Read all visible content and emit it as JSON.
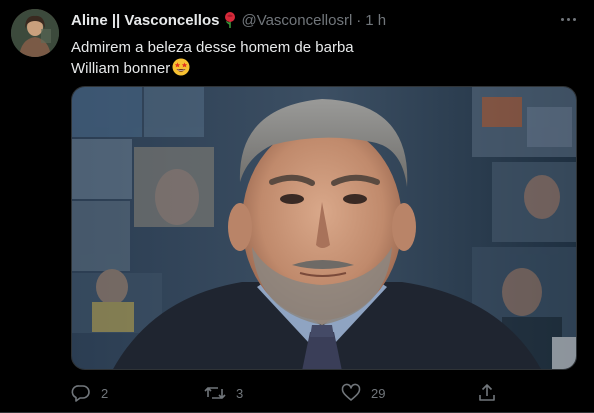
{
  "tweet": {
    "display_name": "Aline || Vasconcellos",
    "name_emoji": "rose-icon",
    "handle": "@Vasconcellosrl",
    "separator": "·",
    "time": "1 h",
    "text_line1": "Admirem a beleza desse homem de barba",
    "text_line2": "William bonner",
    "text_emoji": "star-struck-emoji-icon"
  },
  "actions": {
    "reply_count": "2",
    "retweet_count": "3",
    "like_count": "29",
    "share_label": ""
  },
  "colors": {
    "background": "#000000",
    "primary_text": "#e7e9ea",
    "secondary_text": "#71767b",
    "border": "#2f3336"
  }
}
